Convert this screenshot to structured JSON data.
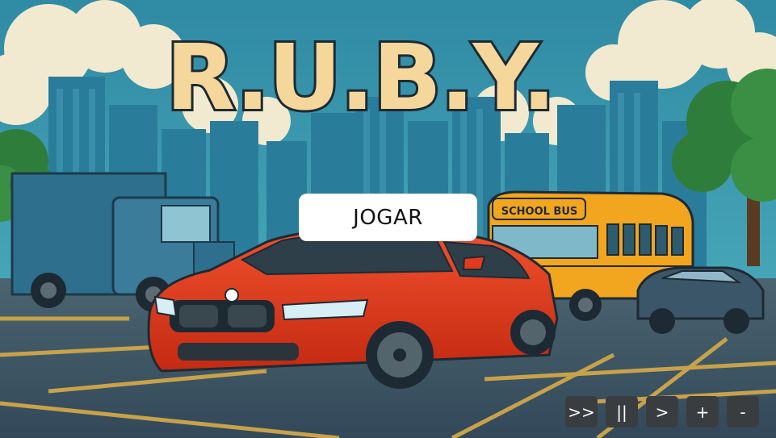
{
  "game": {
    "title": "R.U.B.Y.",
    "bus_sign": "SCHOOL BUS",
    "play_label": "JOGAR"
  },
  "controls": {
    "fast_forward_label": ">>",
    "pause_label": "||",
    "play_label": ">",
    "zoom_in_label": "+",
    "zoom_out_label": "-"
  },
  "colors": {
    "sky": "#3a9ab4",
    "cloud": "#f2ead0",
    "title_fill": "#f5d79c",
    "title_outline": "#1d2a33",
    "car_red": "#e23a1c",
    "bus_yellow": "#f2a51e",
    "truck_blue": "#2f6f8e",
    "asphalt": "#3f5a66",
    "lane_line": "#c8a24a",
    "control_bg": "#3a3d40"
  }
}
